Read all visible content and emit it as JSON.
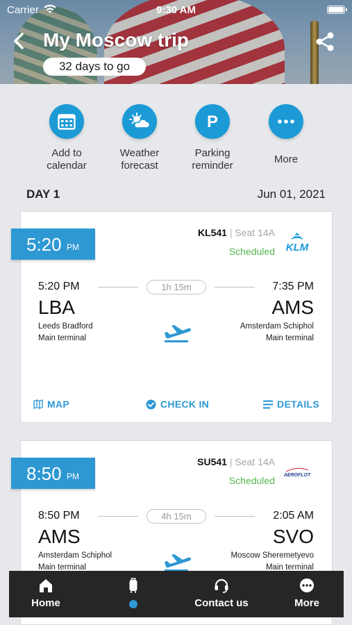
{
  "status_bar": {
    "carrier": "Carrier",
    "time": "9:30 AM"
  },
  "header": {
    "title": "My Moscow trip",
    "countdown": "32 days to go"
  },
  "quick_actions": [
    {
      "icon": "calendar-icon",
      "label_line1": "Add to",
      "label_line2": "calendar"
    },
    {
      "icon": "weather-icon",
      "label_line1": "Weather",
      "label_line2": "forecast"
    },
    {
      "icon": "parking-icon",
      "label_line1": "Parking",
      "label_line2": "reminder"
    },
    {
      "icon": "more-dots-icon",
      "label_line1": "More",
      "label_line2": ""
    }
  ],
  "day": {
    "label": "DAY 1",
    "date": "Jun 01, 2021"
  },
  "flights": [
    {
      "time_tag": "5:20",
      "time_tag_suffix": "PM",
      "flight_no": "KL541",
      "separator": "|",
      "seat": "Seat 14A",
      "status": "Scheduled",
      "airline_logo": "KLM",
      "dep_time": "5:20 PM",
      "arr_time": "7:35 PM",
      "duration": "1h 15m",
      "dep_code": "LBA",
      "arr_code": "AMS",
      "dep_name": "Leeds Bradford",
      "dep_terminal": "Main terminal",
      "arr_name": "Amsterdam Schiphol",
      "arr_terminal": "Main terminal",
      "actions": {
        "map": "MAP",
        "check_in": "CHECK IN",
        "details": "DETAILS"
      }
    },
    {
      "time_tag": "8:50",
      "time_tag_suffix": "PM",
      "flight_no": "SU541",
      "separator": "|",
      "seat": "Seat 14A",
      "status": "Scheduled",
      "airline_logo": "AEROFLOT",
      "dep_time": "8:50 PM",
      "arr_time": "2:05 AM",
      "duration": "4h 15m",
      "dep_code": "AMS",
      "arr_code": "SVO",
      "dep_name": "Amsterdam Schiphol",
      "dep_terminal": "Main terminal",
      "arr_name": "Moscow Sheremetyevo",
      "arr_terminal": "Main terminal"
    }
  ],
  "tab_bar": {
    "home": "Home",
    "contact": "Contact us",
    "more": "More"
  },
  "colors": {
    "accent": "#2e98d3",
    "status_green": "#55b84d",
    "tab_bar": "#262626"
  }
}
